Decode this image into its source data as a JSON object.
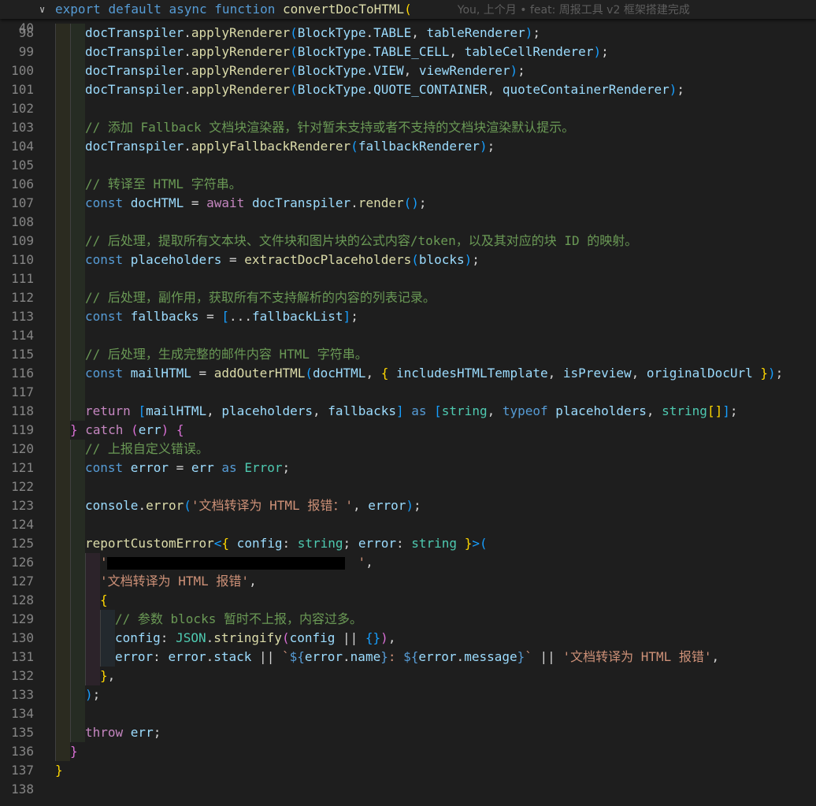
{
  "sticky": {
    "line_number": "40",
    "fold_icon": "chevron-down-icon",
    "code_segments": [
      {
        "t": "export ",
        "c": "k"
      },
      {
        "t": "default ",
        "c": "k"
      },
      {
        "t": "async ",
        "c": "k"
      },
      {
        "t": "function ",
        "c": "k"
      },
      {
        "t": "convertDocToHTML",
        "c": "f"
      },
      {
        "t": "(",
        "c": "b1"
      }
    ],
    "blame": "You, 上个月 • feat: 周报工具 v2 框架搭建完成"
  },
  "lines": [
    {
      "n": "98",
      "indent": 2,
      "segs": [
        {
          "t": "docTranspiler",
          "c": "v"
        },
        {
          "t": ".",
          "c": "p"
        },
        {
          "t": "applyRenderer",
          "c": "f"
        },
        {
          "t": "(",
          "c": "b3"
        },
        {
          "t": "BlockType",
          "c": "v"
        },
        {
          "t": ".",
          "c": "p"
        },
        {
          "t": "TABLE",
          "c": "v"
        },
        {
          "t": ", ",
          "c": "p"
        },
        {
          "t": "tableRenderer",
          "c": "v"
        },
        {
          "t": ")",
          "c": "b3"
        },
        {
          "t": ";",
          "c": "p"
        }
      ]
    },
    {
      "n": "99",
      "indent": 2,
      "segs": [
        {
          "t": "docTranspiler",
          "c": "v"
        },
        {
          "t": ".",
          "c": "p"
        },
        {
          "t": "applyRenderer",
          "c": "f"
        },
        {
          "t": "(",
          "c": "b3"
        },
        {
          "t": "BlockType",
          "c": "v"
        },
        {
          "t": ".",
          "c": "p"
        },
        {
          "t": "TABLE_CELL",
          "c": "v"
        },
        {
          "t": ", ",
          "c": "p"
        },
        {
          "t": "tableCellRenderer",
          "c": "v"
        },
        {
          "t": ")",
          "c": "b3"
        },
        {
          "t": ";",
          "c": "p"
        }
      ]
    },
    {
      "n": "100",
      "indent": 2,
      "segs": [
        {
          "t": "docTranspiler",
          "c": "v"
        },
        {
          "t": ".",
          "c": "p"
        },
        {
          "t": "applyRenderer",
          "c": "f"
        },
        {
          "t": "(",
          "c": "b3"
        },
        {
          "t": "BlockType",
          "c": "v"
        },
        {
          "t": ".",
          "c": "p"
        },
        {
          "t": "VIEW",
          "c": "v"
        },
        {
          "t": ", ",
          "c": "p"
        },
        {
          "t": "viewRenderer",
          "c": "v"
        },
        {
          "t": ")",
          "c": "b3"
        },
        {
          "t": ";",
          "c": "p"
        }
      ]
    },
    {
      "n": "101",
      "indent": 2,
      "segs": [
        {
          "t": "docTranspiler",
          "c": "v"
        },
        {
          "t": ".",
          "c": "p"
        },
        {
          "t": "applyRenderer",
          "c": "f"
        },
        {
          "t": "(",
          "c": "b3"
        },
        {
          "t": "BlockType",
          "c": "v"
        },
        {
          "t": ".",
          "c": "p"
        },
        {
          "t": "QUOTE_CONTAINER",
          "c": "v"
        },
        {
          "t": ", ",
          "c": "p"
        },
        {
          "t": "quoteContainerRenderer",
          "c": "v"
        },
        {
          "t": ")",
          "c": "b3"
        },
        {
          "t": ";",
          "c": "p"
        }
      ]
    },
    {
      "n": "102",
      "indent": 2,
      "segs": []
    },
    {
      "n": "103",
      "indent": 2,
      "segs": [
        {
          "t": "// 添加 Fallback 文档块渲染器，针对暂未支持或者不支持的文档块渲染默认提示。",
          "c": "cm"
        }
      ]
    },
    {
      "n": "104",
      "indent": 2,
      "segs": [
        {
          "t": "docTranspiler",
          "c": "v"
        },
        {
          "t": ".",
          "c": "p"
        },
        {
          "t": "applyFallbackRenderer",
          "c": "f"
        },
        {
          "t": "(",
          "c": "b3"
        },
        {
          "t": "fallbackRenderer",
          "c": "v"
        },
        {
          "t": ")",
          "c": "b3"
        },
        {
          "t": ";",
          "c": "p"
        }
      ]
    },
    {
      "n": "105",
      "indent": 2,
      "segs": []
    },
    {
      "n": "106",
      "indent": 2,
      "segs": [
        {
          "t": "// 转译至 HTML 字符串。",
          "c": "cm"
        }
      ]
    },
    {
      "n": "107",
      "indent": 2,
      "segs": [
        {
          "t": "const ",
          "c": "k"
        },
        {
          "t": "docHTML",
          "c": "v"
        },
        {
          "t": " = ",
          "c": "p"
        },
        {
          "t": "await ",
          "c": "kc"
        },
        {
          "t": "docTranspiler",
          "c": "v"
        },
        {
          "t": ".",
          "c": "p"
        },
        {
          "t": "render",
          "c": "f"
        },
        {
          "t": "()",
          "c": "b3"
        },
        {
          "t": ";",
          "c": "p"
        }
      ]
    },
    {
      "n": "108",
      "indent": 2,
      "segs": []
    },
    {
      "n": "109",
      "indent": 2,
      "segs": [
        {
          "t": "// 后处理，提取所有文本块、文件块和图片块的公式内容/token，以及其对应的块 ID 的映射。",
          "c": "cm"
        }
      ]
    },
    {
      "n": "110",
      "indent": 2,
      "segs": [
        {
          "t": "const ",
          "c": "k"
        },
        {
          "t": "placeholders",
          "c": "v"
        },
        {
          "t": " = ",
          "c": "p"
        },
        {
          "t": "extractDocPlaceholders",
          "c": "f"
        },
        {
          "t": "(",
          "c": "b3"
        },
        {
          "t": "blocks",
          "c": "v"
        },
        {
          "t": ")",
          "c": "b3"
        },
        {
          "t": ";",
          "c": "p"
        }
      ]
    },
    {
      "n": "111",
      "indent": 2,
      "segs": []
    },
    {
      "n": "112",
      "indent": 2,
      "segs": [
        {
          "t": "// 后处理，副作用，获取所有不支持解析的内容的列表记录。",
          "c": "cm"
        }
      ]
    },
    {
      "n": "113",
      "indent": 2,
      "segs": [
        {
          "t": "const ",
          "c": "k"
        },
        {
          "t": "fallbacks",
          "c": "v"
        },
        {
          "t": " = ",
          "c": "p"
        },
        {
          "t": "[",
          "c": "b3"
        },
        {
          "t": "...",
          "c": "p"
        },
        {
          "t": "fallbackList",
          "c": "v"
        },
        {
          "t": "]",
          "c": "b3"
        },
        {
          "t": ";",
          "c": "p"
        }
      ]
    },
    {
      "n": "114",
      "indent": 2,
      "segs": []
    },
    {
      "n": "115",
      "indent": 2,
      "segs": [
        {
          "t": "// 后处理，生成完整的邮件内容 HTML 字符串。",
          "c": "cm"
        }
      ]
    },
    {
      "n": "116",
      "indent": 2,
      "segs": [
        {
          "t": "const ",
          "c": "k"
        },
        {
          "t": "mailHTML",
          "c": "v"
        },
        {
          "t": " = ",
          "c": "p"
        },
        {
          "t": "addOuterHTML",
          "c": "f"
        },
        {
          "t": "(",
          "c": "b3"
        },
        {
          "t": "docHTML",
          "c": "v"
        },
        {
          "t": ", ",
          "c": "p"
        },
        {
          "t": "{",
          "c": "b1"
        },
        {
          "t": " includesHTMLTemplate",
          "c": "v"
        },
        {
          "t": ", ",
          "c": "p"
        },
        {
          "t": "isPreview",
          "c": "v"
        },
        {
          "t": ", ",
          "c": "p"
        },
        {
          "t": "originalDocUrl ",
          "c": "v"
        },
        {
          "t": "}",
          "c": "b1"
        },
        {
          "t": ")",
          "c": "b3"
        },
        {
          "t": ";",
          "c": "p"
        }
      ]
    },
    {
      "n": "117",
      "indent": 2,
      "segs": []
    },
    {
      "n": "118",
      "indent": 2,
      "segs": [
        {
          "t": "return ",
          "c": "kc"
        },
        {
          "t": "[",
          "c": "b3"
        },
        {
          "t": "mailHTML",
          "c": "v"
        },
        {
          "t": ", ",
          "c": "p"
        },
        {
          "t": "placeholders",
          "c": "v"
        },
        {
          "t": ", ",
          "c": "p"
        },
        {
          "t": "fallbacks",
          "c": "v"
        },
        {
          "t": "]",
          "c": "b3"
        },
        {
          "t": " as ",
          "c": "k"
        },
        {
          "t": "[",
          "c": "b3"
        },
        {
          "t": "string",
          "c": "c"
        },
        {
          "t": ", ",
          "c": "p"
        },
        {
          "t": "typeof ",
          "c": "k"
        },
        {
          "t": "placeholders",
          "c": "v"
        },
        {
          "t": ", ",
          "c": "p"
        },
        {
          "t": "string",
          "c": "c"
        },
        {
          "t": "[]",
          "c": "b1"
        },
        {
          "t": "]",
          "c": "b3"
        },
        {
          "t": ";",
          "c": "p"
        }
      ]
    },
    {
      "n": "119",
      "indent": 1,
      "segs": [
        {
          "t": "} ",
          "c": "b2"
        },
        {
          "t": "catch ",
          "c": "kc"
        },
        {
          "t": "(",
          "c": "b2"
        },
        {
          "t": "err",
          "c": "v"
        },
        {
          "t": ") ",
          "c": "b2"
        },
        {
          "t": "{",
          "c": "b2"
        }
      ]
    },
    {
      "n": "120",
      "indent": 2,
      "segs": [
        {
          "t": "// 上报自定义错误。",
          "c": "cm"
        }
      ]
    },
    {
      "n": "121",
      "indent": 2,
      "segs": [
        {
          "t": "const ",
          "c": "k"
        },
        {
          "t": "error",
          "c": "v"
        },
        {
          "t": " = ",
          "c": "p"
        },
        {
          "t": "err",
          "c": "v"
        },
        {
          "t": " as ",
          "c": "k"
        },
        {
          "t": "Error",
          "c": "c"
        },
        {
          "t": ";",
          "c": "p"
        }
      ]
    },
    {
      "n": "122",
      "indent": 2,
      "segs": []
    },
    {
      "n": "123",
      "indent": 2,
      "segs": [
        {
          "t": "console",
          "c": "v"
        },
        {
          "t": ".",
          "c": "p"
        },
        {
          "t": "error",
          "c": "f"
        },
        {
          "t": "(",
          "c": "b3"
        },
        {
          "t": "'文档转译为 HTML 报错：'",
          "c": "s"
        },
        {
          "t": ", ",
          "c": "p"
        },
        {
          "t": "error",
          "c": "v"
        },
        {
          "t": ")",
          "c": "b3"
        },
        {
          "t": ";",
          "c": "p"
        }
      ]
    },
    {
      "n": "124",
      "indent": 2,
      "segs": []
    },
    {
      "n": "125",
      "indent": 2,
      "segs": [
        {
          "t": "reportCustomError",
          "c": "f"
        },
        {
          "t": "<",
          "c": "b3"
        },
        {
          "t": "{",
          "c": "b1"
        },
        {
          "t": " config",
          "c": "v"
        },
        {
          "t": ": ",
          "c": "p"
        },
        {
          "t": "string",
          "c": "c"
        },
        {
          "t": "; ",
          "c": "p"
        },
        {
          "t": "error",
          "c": "v"
        },
        {
          "t": ": ",
          "c": "p"
        },
        {
          "t": "string ",
          "c": "c"
        },
        {
          "t": "}",
          "c": "b1"
        },
        {
          "t": ">(",
          "c": "b3"
        }
      ]
    },
    {
      "n": "126",
      "indent": 3,
      "redacted": true,
      "segs": [
        {
          "t": "'",
          "c": "s"
        },
        {
          "t": "                                 ",
          "c": "s"
        },
        {
          "t": "'",
          "c": "s"
        },
        {
          "t": ",",
          "c": "p"
        }
      ]
    },
    {
      "n": "127",
      "indent": 3,
      "segs": [
        {
          "t": "'文档转译为 HTML 报错'",
          "c": "s"
        },
        {
          "t": ",",
          "c": "p"
        }
      ]
    },
    {
      "n": "128",
      "indent": 3,
      "segs": [
        {
          "t": "{",
          "c": "b1"
        }
      ]
    },
    {
      "n": "129",
      "indent": 4,
      "segs": [
        {
          "t": "// 参数 blocks 暂时不上报，内容过多。",
          "c": "cm"
        }
      ]
    },
    {
      "n": "130",
      "indent": 4,
      "segs": [
        {
          "t": "config",
          "c": "v"
        },
        {
          "t": ": ",
          "c": "p"
        },
        {
          "t": "JSON",
          "c": "c"
        },
        {
          "t": ".",
          "c": "p"
        },
        {
          "t": "stringify",
          "c": "f"
        },
        {
          "t": "(",
          "c": "b2"
        },
        {
          "t": "config",
          "c": "v"
        },
        {
          "t": " || ",
          "c": "p"
        },
        {
          "t": "{}",
          "c": "b3"
        },
        {
          "t": ")",
          "c": "b2"
        },
        {
          "t": ",",
          "c": "p"
        }
      ]
    },
    {
      "n": "131",
      "indent": 4,
      "segs": [
        {
          "t": "error",
          "c": "v"
        },
        {
          "t": ": ",
          "c": "p"
        },
        {
          "t": "error",
          "c": "v"
        },
        {
          "t": ".",
          "c": "p"
        },
        {
          "t": "stack",
          "c": "v"
        },
        {
          "t": " || ",
          "c": "p"
        },
        {
          "t": "`",
          "c": "s"
        },
        {
          "t": "${",
          "c": "k"
        },
        {
          "t": "error",
          "c": "v"
        },
        {
          "t": ".",
          "c": "p"
        },
        {
          "t": "name",
          "c": "v"
        },
        {
          "t": "}",
          "c": "k"
        },
        {
          "t": ": ",
          "c": "s"
        },
        {
          "t": "${",
          "c": "k"
        },
        {
          "t": "error",
          "c": "v"
        },
        {
          "t": ".",
          "c": "p"
        },
        {
          "t": "message",
          "c": "v"
        },
        {
          "t": "}",
          "c": "k"
        },
        {
          "t": "`",
          "c": "s"
        },
        {
          "t": " || ",
          "c": "p"
        },
        {
          "t": "'文档转译为 HTML 报错'",
          "c": "s"
        },
        {
          "t": ",",
          "c": "p"
        }
      ]
    },
    {
      "n": "132",
      "indent": 3,
      "segs": [
        {
          "t": "}",
          "c": "b1"
        },
        {
          "t": ",",
          "c": "p"
        }
      ]
    },
    {
      "n": "133",
      "indent": 2,
      "segs": [
        {
          "t": ")",
          "c": "b3"
        },
        {
          "t": ";",
          "c": "p"
        }
      ]
    },
    {
      "n": "134",
      "indent": 2,
      "segs": []
    },
    {
      "n": "135",
      "indent": 2,
      "segs": [
        {
          "t": "throw ",
          "c": "kc"
        },
        {
          "t": "err",
          "c": "v"
        },
        {
          "t": ";",
          "c": "p"
        }
      ]
    },
    {
      "n": "136",
      "indent": 1,
      "segs": [
        {
          "t": "}",
          "c": "b2"
        }
      ]
    },
    {
      "n": "137",
      "indent": 0,
      "segs": [
        {
          "t": "}",
          "c": "b1"
        }
      ]
    },
    {
      "n": "138",
      "indent": 0,
      "segs": []
    }
  ]
}
